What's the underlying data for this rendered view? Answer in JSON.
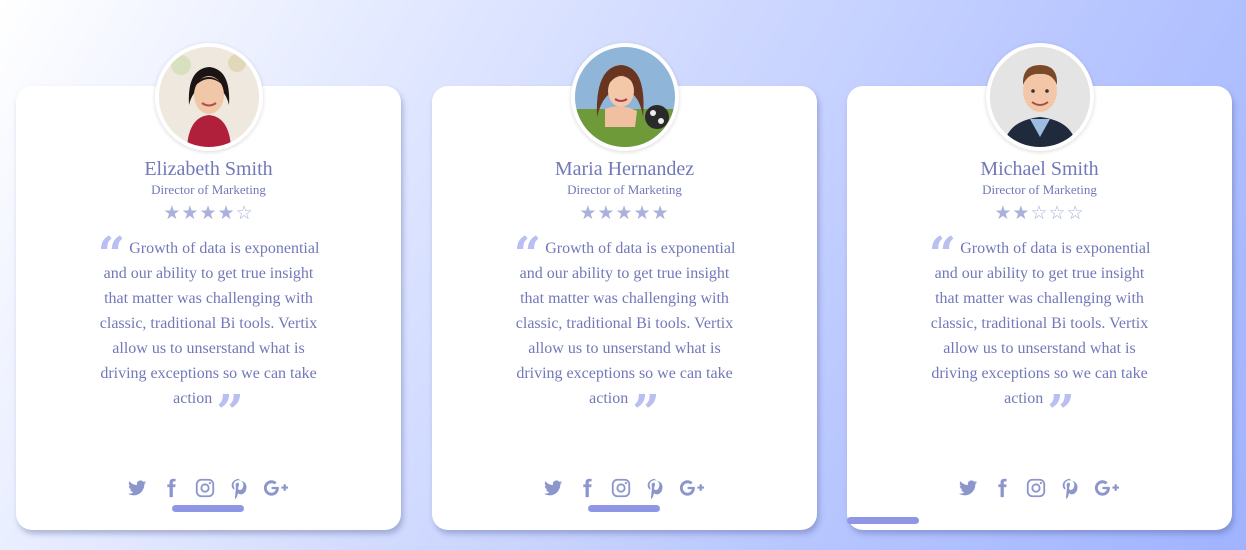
{
  "cards": [
    {
      "name": "Elizabeth Smith",
      "role": "Director of Marketing",
      "rating": 4,
      "quote": "Growth of data is exponential and our ability to get true insight that matter was challenging with classic, traditional Bi tools. Vertix allow us to unserstand what is driving exceptions so we can take action",
      "avatar": "woman-portrait"
    },
    {
      "name": "Maria Hernandez",
      "role": "Director of Marketing",
      "rating": 5,
      "quote": "Growth of data is exponential and our ability to get true insight that matter was challenging with classic, traditional Bi tools. Vertix allow us to unserstand what is driving exceptions so we can take action",
      "avatar": "woman-portrait"
    },
    {
      "name": "Michael Smith",
      "role": "Director of Marketing",
      "rating": 2,
      "quote": "Growth of data is exponential and our ability to get true insight that matter was challenging with classic, traditional Bi tools. Vertix allow us to unserstand what is driving exceptions so we can take action",
      "avatar": "man-portrait"
    }
  ],
  "stars_max": 5,
  "social_icons": [
    "twitter-icon",
    "facebook-icon",
    "instagram-icon",
    "pinterest-icon",
    "google-plus-icon"
  ],
  "colors": {
    "accent": "#7278b8",
    "star_filled": "#aab1dc",
    "quote_mark": "#b9bff0",
    "bar": "#8f97e4"
  }
}
